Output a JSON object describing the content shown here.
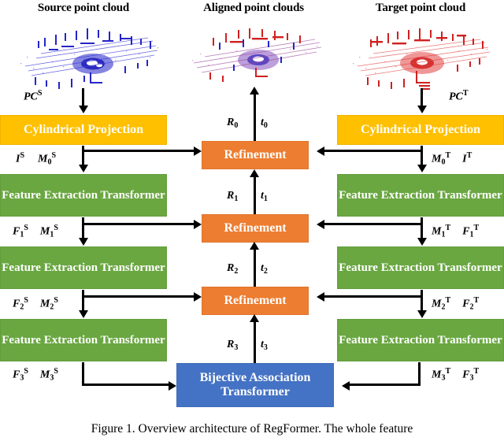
{
  "figure": {
    "caption": "Figure 1. Overview architecture of RegFormer. The whole feature"
  },
  "columns": {
    "source_title": "Source point cloud",
    "aligned_title": "Aligned point clouds",
    "target_title": "Target point cloud"
  },
  "boxes": {
    "cylindrical_projection": "Cylindrical Projection",
    "feature_extraction_transformer": "Feature Extraction Transformer",
    "refinement": "Refinement",
    "bijective_association_transformer": "Bijective Association Transformer"
  },
  "colors": {
    "projection": "#FFC000",
    "feature_extraction": "#6AA741",
    "refinement": "#ED7D31",
    "bijective": "#4472C4",
    "source_cloud": "#2222CC",
    "target_cloud": "#E02020",
    "arrow": "#000000"
  },
  "labels": {
    "pc_source": {
      "base": "PC",
      "sub": "",
      "sup": "S"
    },
    "pc_target": {
      "base": "PC",
      "sub": "",
      "sup": "T"
    },
    "left_l0_a": {
      "base": "I",
      "sub": "",
      "sup": "S"
    },
    "left_l0_b": {
      "base": "M",
      "sub": "0",
      "sup": "S"
    },
    "left_l1_a": {
      "base": "F",
      "sub": "1",
      "sup": "S"
    },
    "left_l1_b": {
      "base": "M",
      "sub": "1",
      "sup": "S"
    },
    "left_l2_a": {
      "base": "F",
      "sub": "2",
      "sup": "S"
    },
    "left_l2_b": {
      "base": "M",
      "sub": "2",
      "sup": "S"
    },
    "left_l3_a": {
      "base": "F",
      "sub": "3",
      "sup": "S"
    },
    "left_l3_b": {
      "base": "M",
      "sub": "3",
      "sup": "S"
    },
    "right_l0_a": {
      "base": "M",
      "sub": "0",
      "sup": "T"
    },
    "right_l0_b": {
      "base": "I",
      "sub": "",
      "sup": "T"
    },
    "right_l1_a": {
      "base": "M",
      "sub": "1",
      "sup": "T"
    },
    "right_l1_b": {
      "base": "F",
      "sub": "1",
      "sup": "T"
    },
    "right_l2_a": {
      "base": "M",
      "sub": "2",
      "sup": "T"
    },
    "right_l2_b": {
      "base": "F",
      "sub": "2",
      "sup": "T"
    },
    "right_l3_a": {
      "base": "M",
      "sub": "3",
      "sup": "T"
    },
    "right_l3_b": {
      "base": "F",
      "sub": "3",
      "sup": "T"
    },
    "R0": {
      "base": "R",
      "sub": "0",
      "sup": ""
    },
    "t0": {
      "base": "t",
      "sub": "0",
      "sup": ""
    },
    "R1": {
      "base": "R",
      "sub": "1",
      "sup": ""
    },
    "t1": {
      "base": "t",
      "sub": "1",
      "sup": ""
    },
    "R2": {
      "base": "R",
      "sub": "2",
      "sup": ""
    },
    "t2": {
      "base": "t",
      "sub": "2",
      "sup": ""
    },
    "R3": {
      "base": "R",
      "sub": "3",
      "sup": ""
    },
    "t3": {
      "base": "t",
      "sub": "3",
      "sup": ""
    }
  }
}
